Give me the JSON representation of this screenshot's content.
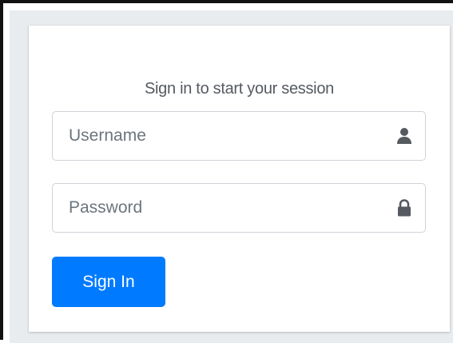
{
  "login": {
    "message": "Sign in to start your session",
    "username": {
      "placeholder": "Username",
      "value": "",
      "icon": "user-icon"
    },
    "password": {
      "placeholder": "Password",
      "value": "",
      "icon": "lock-icon"
    },
    "submit_label": "Sign In"
  },
  "colors": {
    "page_background": "#e9ecef",
    "card_background": "#ffffff",
    "accent": "#007bff",
    "border": "#ced4da",
    "text": "#555a60",
    "icon": "#555a60"
  }
}
